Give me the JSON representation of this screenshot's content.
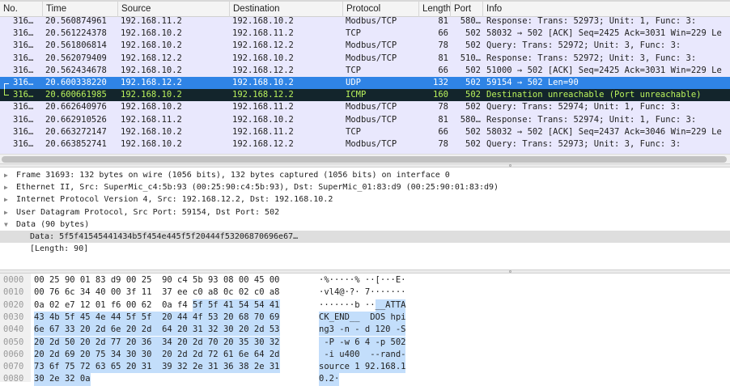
{
  "packet_list": {
    "columns": [
      "No.",
      "Time",
      "Source",
      "Destination",
      "Protocol",
      "Length",
      "Port",
      "Info"
    ],
    "rows": [
      {
        "no": "316…",
        "time": "20.560874961",
        "src": "192.168.11.2",
        "dst": "192.168.10.2",
        "proto": "Modbus/TCP",
        "len": "81",
        "port": "580…",
        "info": "Response: Trans: 52973; Unit:   1, Func:   3:",
        "state": "normal"
      },
      {
        "no": "316…",
        "time": "20.561224378",
        "src": "192.168.10.2",
        "dst": "192.168.11.2",
        "proto": "TCP",
        "len": "66",
        "port": "502",
        "info": "58032 → 502 [ACK] Seq=2425 Ack=3031 Win=229 Le",
        "state": "normal"
      },
      {
        "no": "316…",
        "time": "20.561806814",
        "src": "192.168.10.2",
        "dst": "192.168.12.2",
        "proto": "Modbus/TCP",
        "len": "78",
        "port": "502",
        "info": "   Query: Trans: 52972; Unit:   3, Func:   3:",
        "state": "normal"
      },
      {
        "no": "316…",
        "time": "20.562079409",
        "src": "192.168.12.2",
        "dst": "192.168.10.2",
        "proto": "Modbus/TCP",
        "len": "81",
        "port": "510…",
        "info": "Response: Trans: 52972; Unit:   3, Func:   3:",
        "state": "normal"
      },
      {
        "no": "316…",
        "time": "20.562434678",
        "src": "192.168.10.2",
        "dst": "192.168.12.2",
        "proto": "TCP",
        "len": "66",
        "port": "502",
        "info": "51000 → 502 [ACK] Seq=2425 Ack=3031 Win=229 Le",
        "state": "normal"
      },
      {
        "no": "316…",
        "time": "20.600338220",
        "src": "192.168.12.2",
        "dst": "192.168.10.2",
        "proto": "UDP",
        "len": "132",
        "port": "502",
        "info": "59154 → 502 Len=90",
        "state": "selected"
      },
      {
        "no": "316…",
        "time": "20.600661985",
        "src": "192.168.10.2",
        "dst": "192.168.12.2",
        "proto": "ICMP",
        "len": "160",
        "port": "502",
        "info": "Destination unreachable (Port unreachable)",
        "state": "icmp"
      },
      {
        "no": "316…",
        "time": "20.662640976",
        "src": "192.168.10.2",
        "dst": "192.168.11.2",
        "proto": "Modbus/TCP",
        "len": "78",
        "port": "502",
        "info": "   Query: Trans: 52974; Unit:   1, Func:   3:",
        "state": "normal"
      },
      {
        "no": "316…",
        "time": "20.662910526",
        "src": "192.168.11.2",
        "dst": "192.168.10.2",
        "proto": "Modbus/TCP",
        "len": "81",
        "port": "580…",
        "info": "Response: Trans: 52974; Unit:   1, Func:   3:",
        "state": "normal"
      },
      {
        "no": "316…",
        "time": "20.663272147",
        "src": "192.168.10.2",
        "dst": "192.168.11.2",
        "proto": "TCP",
        "len": "66",
        "port": "502",
        "info": "58032 → 502 [ACK] Seq=2437 Ack=3046 Win=229 Le",
        "state": "normal"
      },
      {
        "no": "316…",
        "time": "20.663852741",
        "src": "192.168.10.2",
        "dst": "192.168.12.2",
        "proto": "Modbus/TCP",
        "len": "78",
        "port": "502",
        "info": "   Query: Trans: 52973; Unit:   3, Func:   3:",
        "state": "normal"
      }
    ]
  },
  "details": [
    {
      "text": "Frame 31693: 132 bytes on wire (1056 bits), 132 bytes captured (1056 bits) on interface 0",
      "expander": "collapsed"
    },
    {
      "text": "Ethernet II, Src: SuperMic_c4:5b:93 (00:25:90:c4:5b:93), Dst: SuperMic_01:83:d9 (00:25:90:01:83:d9)",
      "expander": "collapsed"
    },
    {
      "text": "Internet Protocol Version 4, Src: 192.168.12.2, Dst: 192.168.10.2",
      "expander": "collapsed"
    },
    {
      "text": "User Datagram Protocol, Src Port: 59154, Dst Port: 502",
      "expander": "collapsed"
    },
    {
      "text": "Data (90 bytes)",
      "expander": "expanded"
    },
    {
      "text": "Data: 5f5f41545441434b5f454e445f5f20444f53206870696e67…",
      "expander": "child",
      "highlighted": true
    },
    {
      "text": "[Length: 90]",
      "expander": "child"
    }
  ],
  "bytes": {
    "highlight_start": 42,
    "rows": [
      {
        "offset": "0000",
        "hex": "00 25 90 01 83 d9 00 25 90 c4 5b 93 08 00 45 00",
        "ascii": "·%·····% ··[···E·"
      },
      {
        "offset": "0010",
        "hex": "00 76 6c 34 40 00 3f 11 37 ee c0 a8 0c 02 c0 a8",
        "ascii": "·vl4@·?· 7·······"
      },
      {
        "offset": "0020",
        "hex": "0a 02 e7 12 01 f6 00 62 0a f4 5f 5f 41 54 54 41",
        "ascii": "·······b ··__ATTA"
      },
      {
        "offset": "0030",
        "hex": "43 4b 5f 45 4e 44 5f 5f 20 44 4f 53 20 68 70 69",
        "ascii": "CK_END__  DOS hpi"
      },
      {
        "offset": "0040",
        "hex": "6e 67 33 20 2d 6e 20 2d 64 20 31 32 30 20 2d 53",
        "ascii": "ng3 -n - d 120 -S"
      },
      {
        "offset": "0050",
        "hex": "20 2d 50 20 2d 77 20 36 34 20 2d 70 20 35 30 32",
        "ascii": " -P -w 6 4 -p 502"
      },
      {
        "offset": "0060",
        "hex": "20 2d 69 20 75 34 30 30 20 2d 2d 72 61 6e 64 2d",
        "ascii": " -i u400  --rand-"
      },
      {
        "offset": "0070",
        "hex": "73 6f 75 72 63 65 20 31 39 32 2e 31 36 38 2e 31",
        "ascii": "source 1 92.168.1"
      },
      {
        "offset": "0080",
        "hex": "30 2e 32 0a",
        "ascii": "0.2·"
      }
    ]
  },
  "colors": {
    "row_bg": "#e9e8fd",
    "selected": "#2f84e6",
    "icmp_bg": "#13252c",
    "icmp_fg": "#b9f25c",
    "byte_highlight": "#c3defb"
  }
}
